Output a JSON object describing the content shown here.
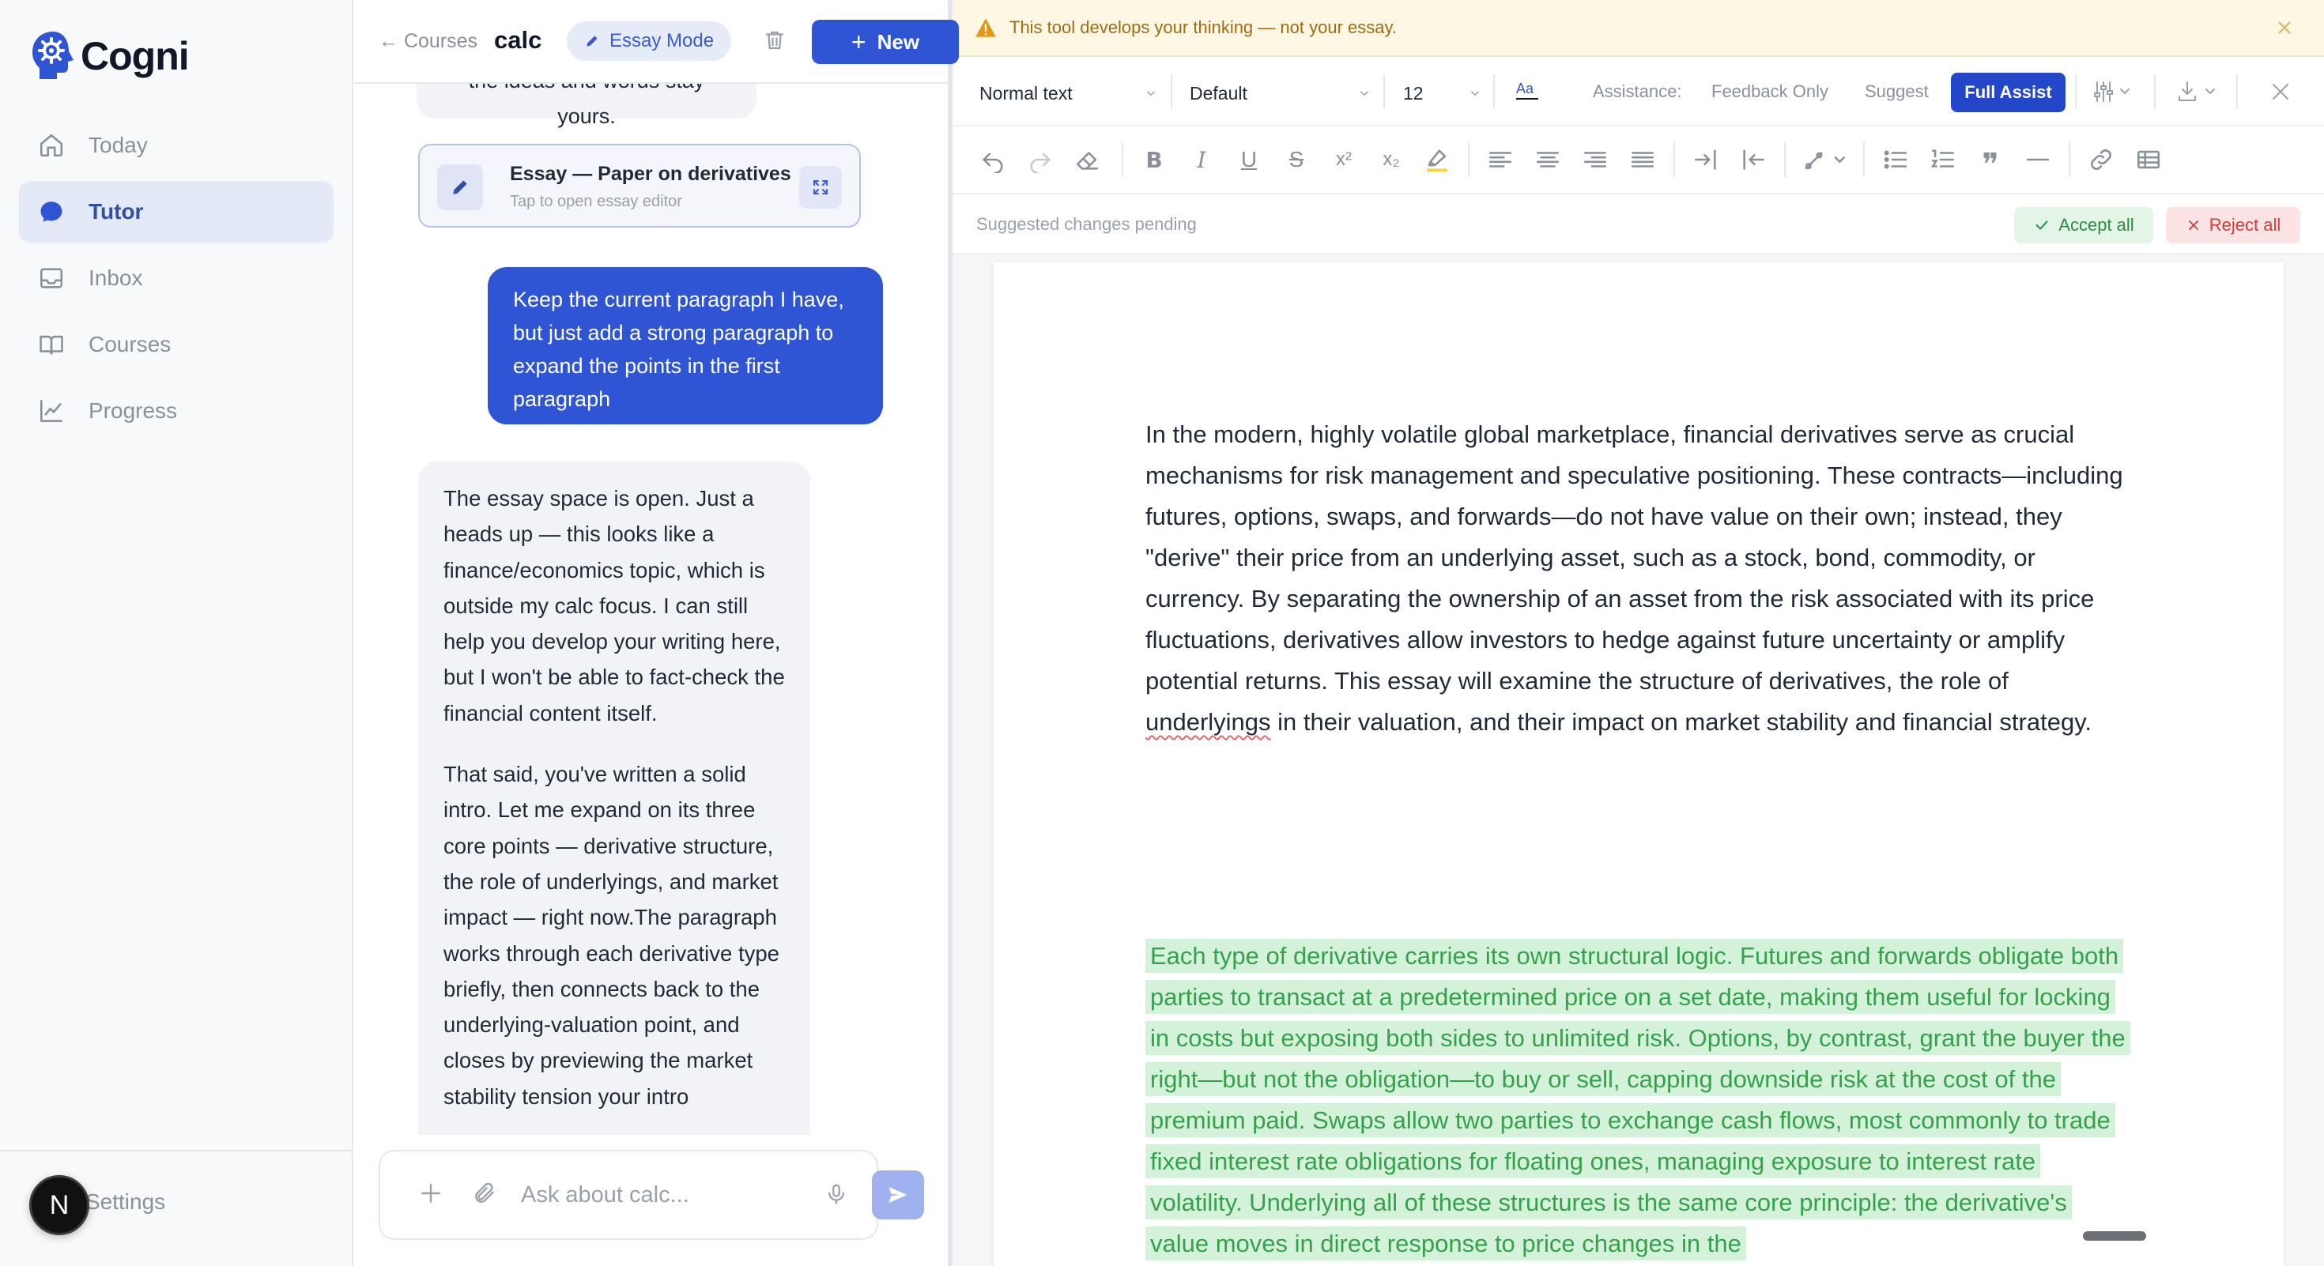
{
  "app": {
    "brand": "Cogni"
  },
  "sidebar": {
    "items": [
      {
        "label": "Today",
        "icon": "home-icon",
        "active": false
      },
      {
        "label": "Tutor",
        "icon": "chat-icon",
        "active": true
      },
      {
        "label": "Inbox",
        "icon": "inbox-icon",
        "active": false
      },
      {
        "label": "Courses",
        "icon": "book-icon",
        "active": false
      },
      {
        "label": "Progress",
        "icon": "chart-icon",
        "active": false
      }
    ],
    "settings_label": "Settings",
    "avatar_letter": "N"
  },
  "chat": {
    "back_label": "← Courses",
    "title": "calc",
    "mode_label": "Essay Mode",
    "new_label": "New",
    "clipped_text": "the ideas and words stay yours.",
    "essay_card": {
      "title": "Essay — Paper on derivatives",
      "subtitle": "Tap to open essay editor"
    },
    "user_message": "Keep the current paragraph I have, but just add a strong paragraph to expand the points in the first paragraph",
    "bot_message": {
      "p1": "The essay space is open. Just a heads up — this looks like a finance/economics topic, which is outside my calc focus. I can still help you develop your writing here, but I won't be able to fact-check the financial content itself.",
      "p2": "That said, you've written a solid intro. Let me expand on its three core points — derivative structure, the role of underlyings, and market impact — right now.The paragraph works through each derivative type briefly, then connects back to the underlying-valuation point, and closes by previewing the market stability tension your intro"
    },
    "input_placeholder": "Ask about calc..."
  },
  "editor": {
    "warning": "This tool develops your thinking — not your essay.",
    "style_select": "Normal text",
    "font_select": "Default",
    "size_select": "12",
    "assistance_label": "Assistance:",
    "assist_options": [
      "Feedback Only",
      "Suggest",
      "Full Assist"
    ],
    "assist_active": "Full Assist",
    "pending_label": "Suggested changes pending",
    "accept_all": "Accept all",
    "reject_all": "Reject all",
    "para1_before": "In the modern, highly volatile global marketplace, financial derivatives serve as crucial mechanisms for risk management and speculative positioning. These contracts—including futures, options, swaps, and forwards—do not have value on their own; instead, they \"derive\" their price from an underlying asset, such as a stock, bond, commodity, or currency. By separating the ownership of an asset from the risk associated with its price fluctuations, derivatives allow investors to hedge against future uncertainty or amplify potential returns. This essay will examine the structure of derivatives, the role of ",
    "para1_flagged": "underlyings",
    "para1_after": " in their valuation, and their impact on market stability and financial strategy.",
    "para2": "Each type of derivative carries its own structural logic. Futures and forwards obligate both parties to transact at a predetermined price on a set date, making them useful for locking in costs but exposing both sides to unlimited risk. Options, by contrast, grant the buyer the right—but not the obligation—to buy or sell, capping downside risk at the cost of the premium paid. Swaps allow two parties to exchange cash flows, most commonly to trade fixed interest rate obligations for floating ones, managing exposure to interest rate volatility. Underlying all of these structures is the same core principle: the derivative's value moves in direct response to price changes in the"
  }
}
